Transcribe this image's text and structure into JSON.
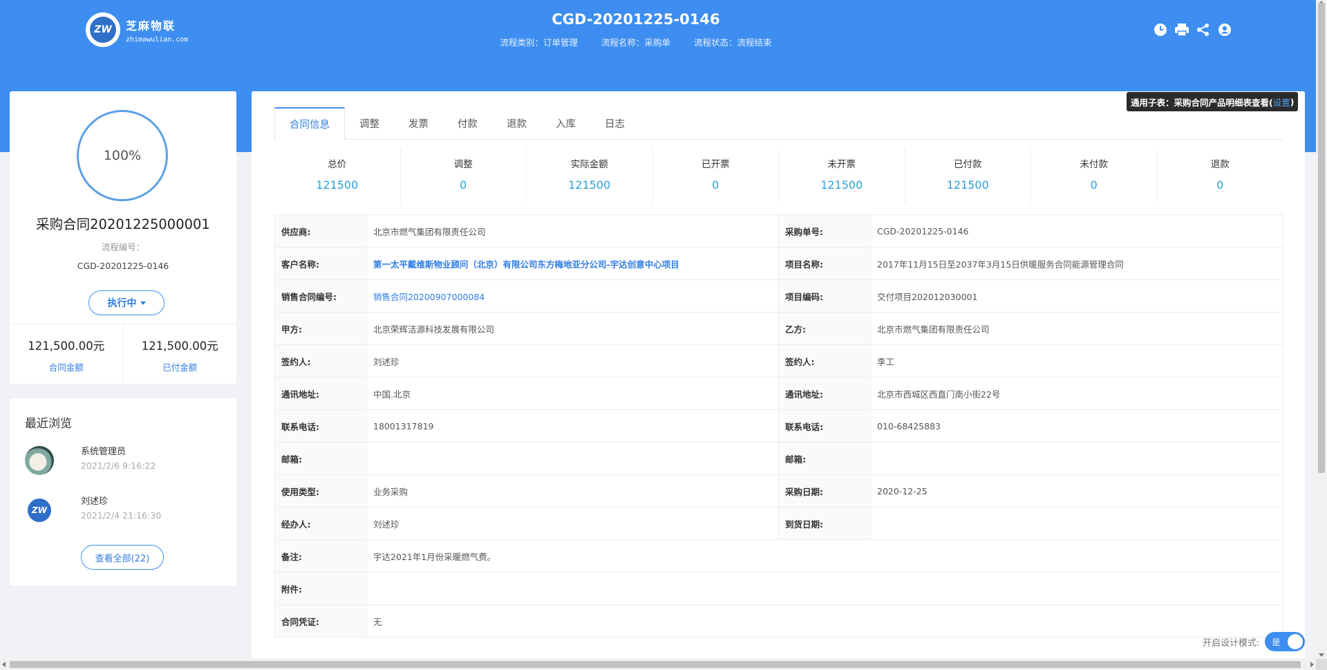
{
  "header": {
    "logo_cn": "芝麻物联",
    "logo_en": "zhimawulian.com",
    "logo_mark": "ZW",
    "title": "CGD-20201225-0146",
    "flow_type": "流程类别：订单管理",
    "flow_name": "流程名称：采购单",
    "flow_status": "流程状态：流程结束",
    "icons": [
      "clock-icon",
      "print-icon",
      "share-icon",
      "user-circle-icon"
    ]
  },
  "summary": {
    "progress": "100%",
    "progress_value": 100,
    "contract_name": "采购合同20201225000001",
    "flow_no_label": "流程编号：",
    "flow_no": "CGD-20201225-0146",
    "status_button": "执行中",
    "contract_amount": "121,500.00元",
    "contract_amount_label": "合同金额",
    "paid_amount": "121,500.00元",
    "paid_amount_label": "已付金额"
  },
  "recent": {
    "title": "最近浏览",
    "items": [
      {
        "name": "系统管理员",
        "time": "2021/2/6 9:16:22"
      },
      {
        "name": "刘述珍",
        "time": "2021/2/4 21:16:30"
      }
    ],
    "view_all": "查看全部(22)"
  },
  "tooltip": {
    "text": "通用子表：采购合同产品明细表查看(",
    "link": "设置",
    "close": ")"
  },
  "tabs": [
    "合同信息",
    "调整",
    "发票",
    "付款",
    "退款",
    "入库",
    "日志"
  ],
  "stats": [
    {
      "label": "总价",
      "value": "121500"
    },
    {
      "label": "调整",
      "value": "0"
    },
    {
      "label": "实际金额",
      "value": "121500"
    },
    {
      "label": "已开票",
      "value": "0"
    },
    {
      "label": "未开票",
      "value": "121500"
    },
    {
      "label": "已付款",
      "value": "121500"
    },
    {
      "label": "未付款",
      "value": "0"
    },
    {
      "label": "退款",
      "value": "0"
    }
  ],
  "info": {
    "supplier_k": "供应商:",
    "supplier_v": "北京市燃气集团有限责任公司",
    "po_no_k": "采购单号:",
    "po_no_v": "CGD-20201225-0146",
    "customer_k": "客户名称:",
    "customer_v": "第一太平戴维斯物业顾问（北京）有限公司东方梅地亚分公司-宇达创意中心项目",
    "project_name_k": "项目名称:",
    "project_name_v": "2017年11月15日至2037年3月15日供暖服务合同能源管理合同",
    "sales_no_k": "销售合同编号:",
    "sales_no_v": "销售合同20200907000084",
    "project_code_k": "项目编码:",
    "project_code_v": "交付项目202012030001",
    "party_a_k": "甲方:",
    "party_a_v": "北京荣辉洁源科技发展有限公司",
    "party_b_k": "乙方:",
    "party_b_v": "北京市燃气集团有限责任公司",
    "signer_a_k": "签约人:",
    "signer_a_v": "刘述珍",
    "signer_b_k": "签约人:",
    "signer_b_v": "李工",
    "addr_a_k": "通讯地址:",
    "addr_a_v": "中国.北京",
    "addr_b_k": "通讯地址:",
    "addr_b_v": "北京市西城区西直门南小街22号",
    "phone_a_k": "联系电话:",
    "phone_a_v": "18001317819",
    "phone_b_k": "联系电话:",
    "phone_b_v": "010-68425883",
    "email_a_k": "邮箱:",
    "email_a_v": "",
    "email_b_k": "邮箱:",
    "email_b_v": "",
    "use_type_k": "使用类型:",
    "use_type_v": "业务采购",
    "po_date_k": "采购日期:",
    "po_date_v": "2020-12-25",
    "handler_k": "经办人:",
    "handler_v": "刘述珍",
    "arrive_date_k": "到货日期:",
    "arrive_date_v": "",
    "remark_k": "备注:",
    "remark_v": "宇达2021年1月份采暖燃气费。",
    "attach_k": "附件:",
    "attach_v": "",
    "voucher_k": "合同凭证:",
    "voucher_v": "无"
  },
  "design_mode": {
    "label": "开启设计模式:",
    "toggle": "是"
  }
}
